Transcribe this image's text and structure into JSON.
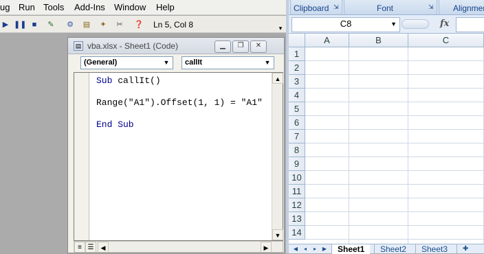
{
  "vbe": {
    "menu": [
      "ug",
      "Run",
      "Tools",
      "Add-Ins",
      "Window",
      "Help"
    ],
    "status": "Ln 5, Col 8",
    "code_window": {
      "title": "vba.xlsx - Sheet1 (Code)",
      "object_dropdown": "(General)",
      "proc_dropdown": "callIt",
      "code": {
        "line1_kw": "Sub",
        "line1_rest": " callIt()",
        "line2": "Range(\"A1\").Offset(1, 1) = \"A1\"",
        "line3_kw": "End Sub"
      }
    }
  },
  "excel": {
    "ribbon_groups": [
      "Clipboard",
      "Font",
      "Alignmen"
    ],
    "name_box": "C8",
    "fx_label": "fx",
    "columns": [
      "A",
      "B",
      "C"
    ],
    "rows": [
      "1",
      "2",
      "3",
      "4",
      "5",
      "6",
      "7",
      "8",
      "9",
      "10",
      "11",
      "12",
      "13",
      "14"
    ],
    "sheets": [
      "Sheet1",
      "Sheet2",
      "Sheet3"
    ],
    "active_sheet": "Sheet1"
  }
}
